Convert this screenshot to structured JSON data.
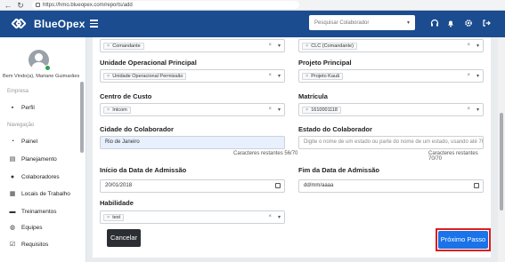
{
  "browser": {
    "url": "https://hmo.blueopex.com/reports/add"
  },
  "header": {
    "brand": "BlueOpex",
    "search_placeholder": "Pesquisar Colaborador",
    "icons": [
      "headset-icon",
      "bell-icon",
      "gear-icon",
      "logout-icon"
    ]
  },
  "sidebar": {
    "welcome": "Bem Vindo(a), Mariane Guimarães",
    "section_empresa": "Empresa",
    "section_navegacao": "Navegação",
    "items": [
      {
        "label": "Perfil",
        "icon": "briefcase-icon"
      },
      {
        "label": "Painel",
        "icon": "dashboard-icon"
      },
      {
        "label": "Planejamento",
        "icon": "calendar-icon"
      },
      {
        "label": "Colaboradores",
        "icon": "users-icon"
      },
      {
        "label": "Locais de Trabalho",
        "icon": "building-icon"
      },
      {
        "label": "Treinamentos",
        "icon": "training-icon"
      },
      {
        "label": "Equipes",
        "icon": "team-icon"
      },
      {
        "label": "Requisitos",
        "icon": "checkbox-icon"
      }
    ]
  },
  "form": {
    "top_left_chip": "Comandante",
    "top_right_chip": "CLC (Comandante)",
    "unidade_label": "Unidade Operacional Principal",
    "unidade_chip": "Unidade Operacional Permissão",
    "projeto_label": "Projeto Principal",
    "projeto_chip": "Projeto Kauã",
    "centro_label": "Centro de Custo",
    "centro_chip": "Intcom",
    "matricula_label": "Matrícula",
    "matricula_chip": "1610001118",
    "cidade_label": "Cidade do Colaborador",
    "cidade_value": "Rio de Janeiro",
    "cidade_counter": "Caracteres restantes 56/70",
    "estado_label": "Estado do Colaborador",
    "estado_placeholder": "Digite o nome de um estado ou parte do nome de um estado, usando até 70 caracteres",
    "estado_counter": "Caracteres restantes 70/70",
    "inicio_label": "Início da Data de Admissão",
    "inicio_value": "20/01/2018",
    "fim_label": "Fim da Data de Admissão",
    "fim_placeholder": "dd/mm/aaaa",
    "habilidade_label": "Habilidade",
    "habilidade_chip": "test",
    "cancel_label": "Cancelar",
    "next_label": "Próximo Passo"
  }
}
